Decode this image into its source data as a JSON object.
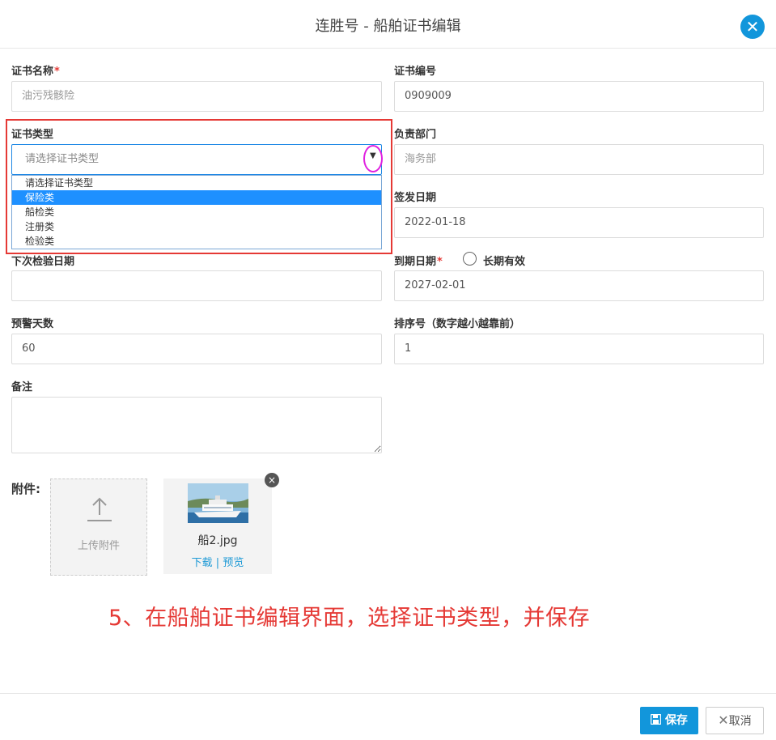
{
  "header": {
    "title": "连胜号 - 船舶证书编辑",
    "close_icon": "close-icon"
  },
  "form": {
    "cert_name": {
      "label": "证书名称",
      "required": "*",
      "placeholder": "油污残骸险"
    },
    "cert_no": {
      "label": "证书编号",
      "value": "0909009"
    },
    "cert_type": {
      "label": "证书类型",
      "placeholder": "请选择证书类型",
      "caret": "▼",
      "options": [
        "请选择证书类型",
        "保险类",
        "船检类",
        "注册类",
        "检验类"
      ],
      "selected_index": 1
    },
    "department": {
      "label": "负责部门",
      "placeholder": "海务部"
    },
    "issue_date": {
      "label": "签发日期",
      "value": "2022-01-18"
    },
    "next_inspection": {
      "label": "下次检验日期",
      "value": ""
    },
    "expiry_date": {
      "label": "到期日期",
      "required": "*",
      "value": "2027-02-01",
      "long_term_label": "长期有效"
    },
    "warning_days": {
      "label": "预警天数",
      "value": "60"
    },
    "sort_no": {
      "label": "排序号（数字越小越靠前）",
      "value": "1"
    },
    "notes": {
      "label": "备注",
      "value": ""
    }
  },
  "attachments": {
    "label": "附件:",
    "upload_label": "上传附件",
    "files": [
      {
        "name": "船2.jpg",
        "download": "下载",
        "separator": "|",
        "preview": "预览",
        "remove": "×"
      }
    ]
  },
  "annotation": "5、在船舶证书编辑界面，选择证书类型，并保存",
  "footer": {
    "save": "保存",
    "cancel": "取消"
  },
  "colors": {
    "primary": "#1296db",
    "highlight": "#e53935",
    "selected_option": "#1e90ff",
    "link": "#1e9ad6"
  }
}
